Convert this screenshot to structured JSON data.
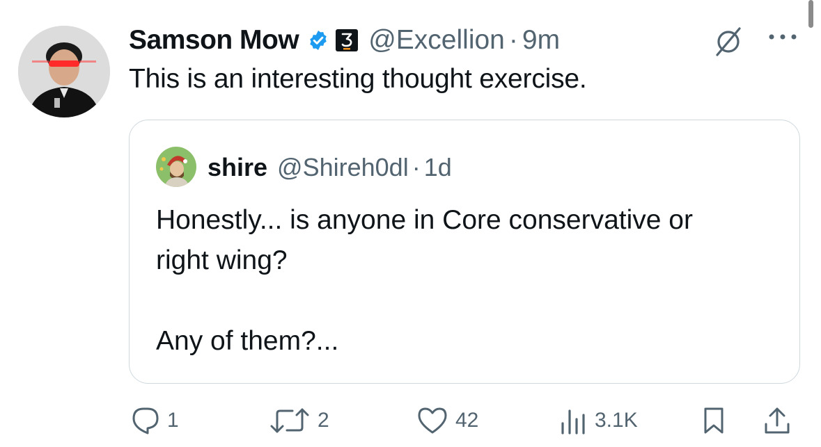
{
  "tweet": {
    "author_name": "Samson Mow",
    "handle": "@Excellion",
    "separator": "·",
    "time": "9m",
    "text": "This is an interesting thought exercise."
  },
  "quoted_tweet": {
    "author_name": "shire",
    "handle": "@Shireh0dl",
    "separator": "·",
    "time": "1d",
    "text": "Honestly... is anyone in Core conservative or\nright wing?\n\nAny of them?..."
  },
  "actions": {
    "replies": "1",
    "reposts": "2",
    "likes": "42",
    "views": "3.1K"
  },
  "icons": {
    "verified": "verified-badge-icon",
    "org": "jan3-badge-icon",
    "grok": "grok-icon",
    "more": "more-icon",
    "reply": "reply-icon",
    "repost": "repost-icon",
    "like": "heart-icon",
    "views": "views-icon",
    "bookmark": "bookmark-icon",
    "share": "share-icon"
  },
  "colors": {
    "text": "#0f1419",
    "secondary": "#536471",
    "verified": "#1d9bf0",
    "border": "#cfd9de"
  }
}
